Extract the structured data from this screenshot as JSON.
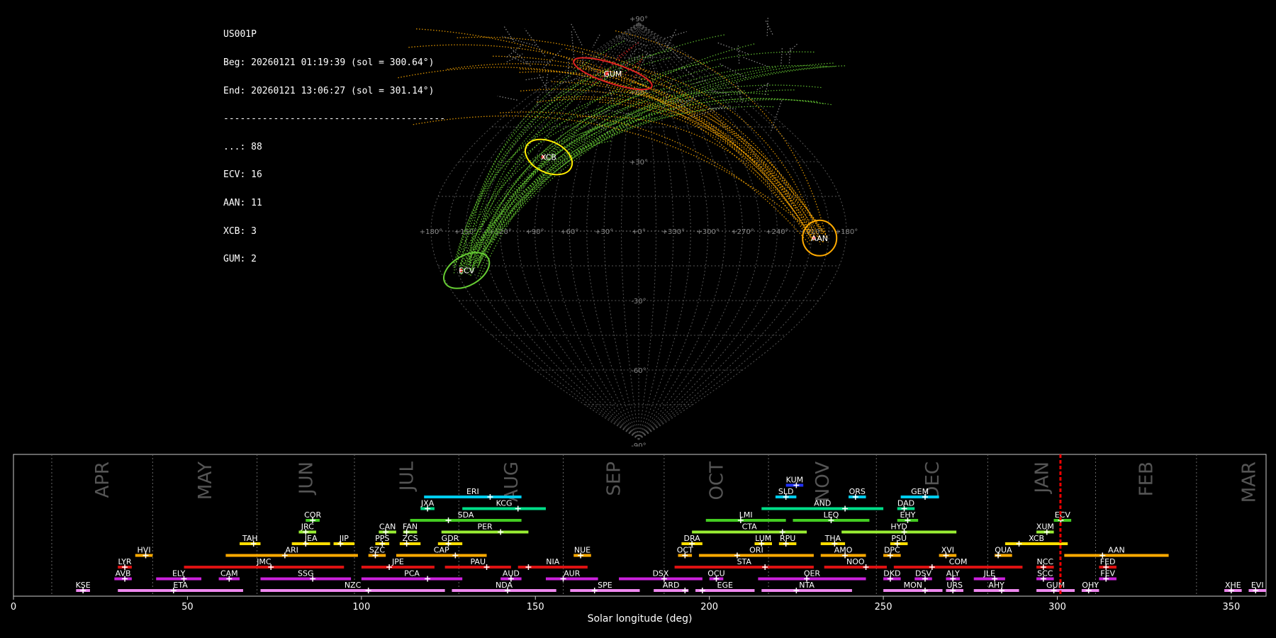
{
  "header": {
    "station": "US001P",
    "begin": "Beg: 20260121 01:19:39 (sol = 300.64°)",
    "end": "End: 20260121 13:06:27 (sol = 301.14°)",
    "divider": "----------------------------------------",
    "counts": [
      {
        "label": "...: 88"
      },
      {
        "label": "ECV: 16"
      },
      {
        "label": "AAN: 11"
      },
      {
        "label": "XCB: 3"
      },
      {
        "label": "GUM: 2"
      }
    ]
  },
  "colors": {
    "background": "#000000",
    "grid": "#555555",
    "sporadic": "#bbbbbb",
    "ecv": "#66cc33",
    "aan": "#ffaa00",
    "xcb": "#ffee00",
    "gum": "#dd2222",
    "marker": "#ff3333"
  },
  "chart_data": [
    {
      "type": "scatter",
      "title": "",
      "projection": "sinusoidal",
      "ra_tick_labels": [
        "+180°",
        "+150°",
        "+120°",
        "+90°",
        "+60°",
        "+30°",
        "+0°",
        "+330°",
        "+300°",
        "+270°",
        "+240°",
        "+210°",
        "+180°"
      ],
      "dec_tick_labels": [
        {
          "dec": 90,
          "label": "+90°"
        },
        {
          "dec": 60,
          "label": "+60°"
        },
        {
          "dec": 30,
          "label": "+30°"
        },
        {
          "dec": -30,
          "label": "-30°"
        },
        {
          "dec": -60,
          "label": "-60°"
        },
        {
          "dec": -90,
          "label": "-90°"
        }
      ],
      "showers": [
        {
          "code": "GUM",
          "ra": 300,
          "dec": 68,
          "color": "#dd2222"
        },
        {
          "code": "XCB",
          "ra": 268,
          "dec": 32,
          "color": "#ffee00"
        },
        {
          "code": "AAN",
          "ra": 157,
          "dec": -3,
          "color": "#ffaa00"
        },
        {
          "code": "ECV",
          "ra": 204,
          "dec": -17,
          "color": "#66cc33"
        }
      ]
    },
    {
      "type": "bar",
      "title": "",
      "xlabel": "Solar longitude (deg)",
      "ylabel": "",
      "xlim": [
        0,
        360
      ],
      "x_ticks": [
        "0",
        "50",
        "100",
        "150",
        "200",
        "250",
        "300",
        "350"
      ],
      "current_sol": 300.9,
      "months": [
        {
          "name": "APR",
          "start": 11
        },
        {
          "name": "MAY",
          "start": 40
        },
        {
          "name": "JUN",
          "start": 70
        },
        {
          "name": "JUL",
          "start": 98
        },
        {
          "name": "AUG",
          "start": 128
        },
        {
          "name": "SEP",
          "start": 158
        },
        {
          "name": "OCT",
          "start": 187
        },
        {
          "name": "NOV",
          "start": 217
        },
        {
          "name": "DEC",
          "start": 248
        },
        {
          "name": "JAN",
          "start": 280
        },
        {
          "name": "FEB",
          "start": 311
        },
        {
          "name": "MAR",
          "start": 340
        }
      ],
      "showers": [
        {
          "code": "KUM",
          "start": 222,
          "end": 227,
          "peak": 225,
          "row": 10,
          "color": "#2233ff"
        },
        {
          "code": "ERI",
          "start": 118,
          "end": 146,
          "peak": 137,
          "row": 9,
          "color": "#00ccee"
        },
        {
          "code": "SLD",
          "start": 219,
          "end": 225,
          "peak": 222,
          "row": 9,
          "color": "#00ccee"
        },
        {
          "code": "ORS",
          "start": 240,
          "end": 245,
          "peak": 242,
          "row": 9,
          "color": "#00ccee"
        },
        {
          "code": "GEM",
          "start": 255,
          "end": 266,
          "peak": 262,
          "row": 9,
          "color": "#00ccee"
        },
        {
          "code": "JXA",
          "start": 117,
          "end": 121,
          "peak": 119,
          "row": 8,
          "color": "#00dd88"
        },
        {
          "code": "KCG",
          "start": 129,
          "end": 153,
          "peak": 145,
          "row": 8,
          "color": "#00dd88"
        },
        {
          "code": "AND",
          "start": 215,
          "end": 250,
          "peak": 239,
          "row": 8,
          "color": "#00dd88"
        },
        {
          "code": "DAD",
          "start": 254,
          "end": 259,
          "peak": 256,
          "row": 8,
          "color": "#00dd88"
        },
        {
          "code": "COR",
          "start": 84,
          "end": 88,
          "peak": 86,
          "row": 7,
          "color": "#44cc22"
        },
        {
          "code": "SDA",
          "start": 114,
          "end": 146,
          "peak": 125,
          "row": 7,
          "color": "#44cc22"
        },
        {
          "code": "LMI",
          "start": 199,
          "end": 222,
          "peak": 209,
          "row": 7,
          "color": "#44cc22"
        },
        {
          "code": "LEQ",
          "start": 224,
          "end": 246,
          "peak": 235,
          "row": 7,
          "color": "#44cc22"
        },
        {
          "code": "EHY",
          "start": 254,
          "end": 260,
          "peak": 257,
          "row": 7,
          "color": "#44cc22"
        },
        {
          "code": "ECV",
          "start": 299,
          "end": 304,
          "peak": 301,
          "row": 7,
          "color": "#44cc22"
        },
        {
          "code": "JRC",
          "start": 82,
          "end": 87,
          "peak": 84,
          "row": 6,
          "color": "#99ee33"
        },
        {
          "code": "CAN",
          "start": 105,
          "end": 110,
          "peak": 107,
          "row": 6,
          "color": "#99ee33"
        },
        {
          "code": "FAN",
          "start": 112,
          "end": 116,
          "peak": 113,
          "row": 6,
          "color": "#99ee33"
        },
        {
          "code": "PER",
          "start": 123,
          "end": 148,
          "peak": 140,
          "row": 6,
          "color": "#99ee33"
        },
        {
          "code": "CTA",
          "start": 195,
          "end": 228,
          "peak": 221,
          "row": 6,
          "color": "#99ee33"
        },
        {
          "code": "HYD",
          "start": 238,
          "end": 271,
          "peak": 256,
          "row": 6,
          "color": "#99ee33"
        },
        {
          "code": "XUM",
          "start": 294,
          "end": 299,
          "peak": 297,
          "row": 6,
          "color": "#99ee33"
        },
        {
          "code": "TAH",
          "start": 65,
          "end": 71,
          "peak": 69,
          "row": 5,
          "color": "#ffdd00"
        },
        {
          "code": "JEA",
          "start": 80,
          "end": 91,
          "peak": 84,
          "row": 5,
          "color": "#ffdd00"
        },
        {
          "code": "JIP",
          "start": 92,
          "end": 98,
          "peak": 94,
          "row": 5,
          "color": "#ffdd00"
        },
        {
          "code": "PPS",
          "start": 104,
          "end": 108,
          "peak": 106,
          "row": 5,
          "color": "#ffdd00"
        },
        {
          "code": "ZCS",
          "start": 111,
          "end": 117,
          "peak": 113,
          "row": 5,
          "color": "#ffdd00"
        },
        {
          "code": "GDR",
          "start": 122,
          "end": 129,
          "peak": 125,
          "row": 5,
          "color": "#ffdd00"
        },
        {
          "code": "DRA",
          "start": 192,
          "end": 198,
          "peak": 195,
          "row": 5,
          "color": "#ffdd00"
        },
        {
          "code": "LUM",
          "start": 213,
          "end": 218,
          "peak": 215,
          "row": 5,
          "color": "#ffdd00"
        },
        {
          "code": "RPU",
          "start": 220,
          "end": 225,
          "peak": 222,
          "row": 5,
          "color": "#ffdd00"
        },
        {
          "code": "THA",
          "start": 232,
          "end": 239,
          "peak": 236,
          "row": 5,
          "color": "#ffdd00"
        },
        {
          "code": "PSU",
          "start": 252,
          "end": 257,
          "peak": 254,
          "row": 5,
          "color": "#ffdd00"
        },
        {
          "code": "XCB",
          "start": 285,
          "end": 303,
          "peak": 289,
          "row": 5,
          "color": "#ffdd00"
        },
        {
          "code": "HVI",
          "start": 35,
          "end": 40,
          "peak": 38,
          "row": 4,
          "color": "#ffaa00"
        },
        {
          "code": "ARI",
          "start": 61,
          "end": 99,
          "peak": 78,
          "row": 4,
          "color": "#ffaa00"
        },
        {
          "code": "SZC",
          "start": 102,
          "end": 107,
          "peak": 104,
          "row": 4,
          "color": "#ffaa00"
        },
        {
          "code": "CAP",
          "start": 110,
          "end": 136,
          "peak": 127,
          "row": 4,
          "color": "#ffaa00"
        },
        {
          "code": "NUE",
          "start": 161,
          "end": 166,
          "peak": 163,
          "row": 4,
          "color": "#ffaa00"
        },
        {
          "code": "OCT",
          "start": 191,
          "end": 195,
          "peak": 193,
          "row": 4,
          "color": "#ffaa00"
        },
        {
          "code": "ORI",
          "start": 197,
          "end": 230,
          "peak": 208,
          "row": 4,
          "color": "#ffaa00"
        },
        {
          "code": "AMO",
          "start": 232,
          "end": 245,
          "peak": 239,
          "row": 4,
          "color": "#ffaa00"
        },
        {
          "code": "DPC",
          "start": 250,
          "end": 255,
          "peak": 252,
          "row": 4,
          "color": "#ffaa00"
        },
        {
          "code": "XVI",
          "start": 266,
          "end": 271,
          "peak": 268,
          "row": 4,
          "color": "#ffaa00"
        },
        {
          "code": "QUA",
          "start": 282,
          "end": 287,
          "peak": 283,
          "row": 4,
          "color": "#ffaa00"
        },
        {
          "code": "AAN",
          "start": 302,
          "end": 332,
          "peak": 313,
          "row": 4,
          "color": "#ffaa00"
        },
        {
          "code": "LYR",
          "start": 30,
          "end": 34,
          "peak": 32,
          "row": 3,
          "color": "#dd1111"
        },
        {
          "code": "JMC",
          "start": 49,
          "end": 95,
          "peak": 74,
          "row": 3,
          "color": "#dd1111"
        },
        {
          "code": "JPE",
          "start": 100,
          "end": 121,
          "peak": 108,
          "row": 3,
          "color": "#dd1111"
        },
        {
          "code": "PAU",
          "start": 124,
          "end": 143,
          "peak": 136,
          "row": 3,
          "color": "#dd1111"
        },
        {
          "code": "NIA",
          "start": 145,
          "end": 165,
          "peak": 148,
          "row": 3,
          "color": "#dd1111"
        },
        {
          "code": "STA",
          "start": 190,
          "end": 230,
          "peak": 216,
          "row": 3,
          "color": "#dd1111"
        },
        {
          "code": "NOO",
          "start": 233,
          "end": 251,
          "peak": 245,
          "row": 3,
          "color": "#dd1111"
        },
        {
          "code": "COM",
          "start": 253,
          "end": 290,
          "peak": 264,
          "row": 3,
          "color": "#dd1111"
        },
        {
          "code": "NCC",
          "start": 294,
          "end": 299,
          "peak": 296,
          "row": 3,
          "color": "#dd1111"
        },
        {
          "code": "FED",
          "start": 312,
          "end": 317,
          "peak": 314,
          "row": 3,
          "color": "#dd1111"
        },
        {
          "code": "AVB",
          "start": 29,
          "end": 34,
          "peak": 32,
          "row": 2,
          "color": "#cc22dd"
        },
        {
          "code": "ELY",
          "start": 41,
          "end": 54,
          "peak": 49,
          "row": 2,
          "color": "#cc22dd"
        },
        {
          "code": "CAM",
          "start": 59,
          "end": 65,
          "peak": 62,
          "row": 2,
          "color": "#cc22dd"
        },
        {
          "code": "SSG",
          "start": 71,
          "end": 97,
          "peak": 86,
          "row": 2,
          "color": "#cc22dd"
        },
        {
          "code": "PCA",
          "start": 100,
          "end": 129,
          "peak": 119,
          "row": 2,
          "color": "#cc22dd"
        },
        {
          "code": "AUD",
          "start": 140,
          "end": 146,
          "peak": 143,
          "row": 2,
          "color": "#cc22dd"
        },
        {
          "code": "AUR",
          "start": 153,
          "end": 168,
          "peak": 158,
          "row": 2,
          "color": "#cc22dd"
        },
        {
          "code": "DSX",
          "start": 174,
          "end": 198,
          "peak": 187,
          "row": 2,
          "color": "#cc22dd"
        },
        {
          "code": "OCU",
          "start": 200,
          "end": 204,
          "peak": 202,
          "row": 2,
          "color": "#cc22dd"
        },
        {
          "code": "OER",
          "start": 214,
          "end": 245,
          "peak": 228,
          "row": 2,
          "color": "#cc22dd"
        },
        {
          "code": "DKD",
          "start": 250,
          "end": 255,
          "peak": 252,
          "row": 2,
          "color": "#cc22dd"
        },
        {
          "code": "DSV",
          "start": 259,
          "end": 264,
          "peak": 262,
          "row": 2,
          "color": "#cc22dd"
        },
        {
          "code": "ALY",
          "start": 268,
          "end": 272,
          "peak": 270,
          "row": 2,
          "color": "#cc22dd"
        },
        {
          "code": "JLE",
          "start": 276,
          "end": 285,
          "peak": 282,
          "row": 2,
          "color": "#cc22dd"
        },
        {
          "code": "SCC",
          "start": 294,
          "end": 299,
          "peak": 296,
          "row": 2,
          "color": "#cc22dd"
        },
        {
          "code": "FEV",
          "start": 312,
          "end": 317,
          "peak": 314,
          "row": 2,
          "color": "#cc22dd"
        },
        {
          "code": "KSE",
          "start": 18,
          "end": 22,
          "peak": 20,
          "row": 1,
          "color": "#ee88ee"
        },
        {
          "code": "ETA",
          "start": 30,
          "end": 66,
          "peak": 46,
          "row": 1,
          "color": "#ee88ee"
        },
        {
          "code": "NZC",
          "start": 71,
          "end": 124,
          "peak": 102,
          "row": 1,
          "color": "#ee88ee"
        },
        {
          "code": "NDA",
          "start": 126,
          "end": 156,
          "peak": 142,
          "row": 1,
          "color": "#ee88ee"
        },
        {
          "code": "SPE",
          "start": 160,
          "end": 180,
          "peak": 167,
          "row": 1,
          "color": "#ee88ee"
        },
        {
          "code": "ARD",
          "start": 184,
          "end": 194,
          "peak": 193,
          "row": 1,
          "color": "#ee88ee"
        },
        {
          "code": "EGE",
          "start": 196,
          "end": 213,
          "peak": 198,
          "row": 1,
          "color": "#ee88ee"
        },
        {
          "code": "NTA",
          "start": 215,
          "end": 241,
          "peak": 225,
          "row": 1,
          "color": "#ee88ee"
        },
        {
          "code": "MON",
          "start": 250,
          "end": 267,
          "peak": 262,
          "row": 1,
          "color": "#ee88ee"
        },
        {
          "code": "URS",
          "start": 268,
          "end": 273,
          "peak": 270,
          "row": 1,
          "color": "#ee88ee"
        },
        {
          "code": "AHY",
          "start": 276,
          "end": 289,
          "peak": 284,
          "row": 1,
          "color": "#ee88ee"
        },
        {
          "code": "GUM",
          "start": 294,
          "end": 305,
          "peak": 299,
          "row": 1,
          "color": "#ee88ee"
        },
        {
          "code": "OHY",
          "start": 307,
          "end": 312,
          "peak": 309,
          "row": 1,
          "color": "#ee88ee"
        },
        {
          "code": "XHE",
          "start": 348,
          "end": 353,
          "peak": 350,
          "row": 1,
          "color": "#ee88ee"
        },
        {
          "code": "EVI",
          "start": 355,
          "end": 360,
          "peak": 357,
          "row": 1,
          "color": "#ee88ee"
        }
      ]
    }
  ]
}
